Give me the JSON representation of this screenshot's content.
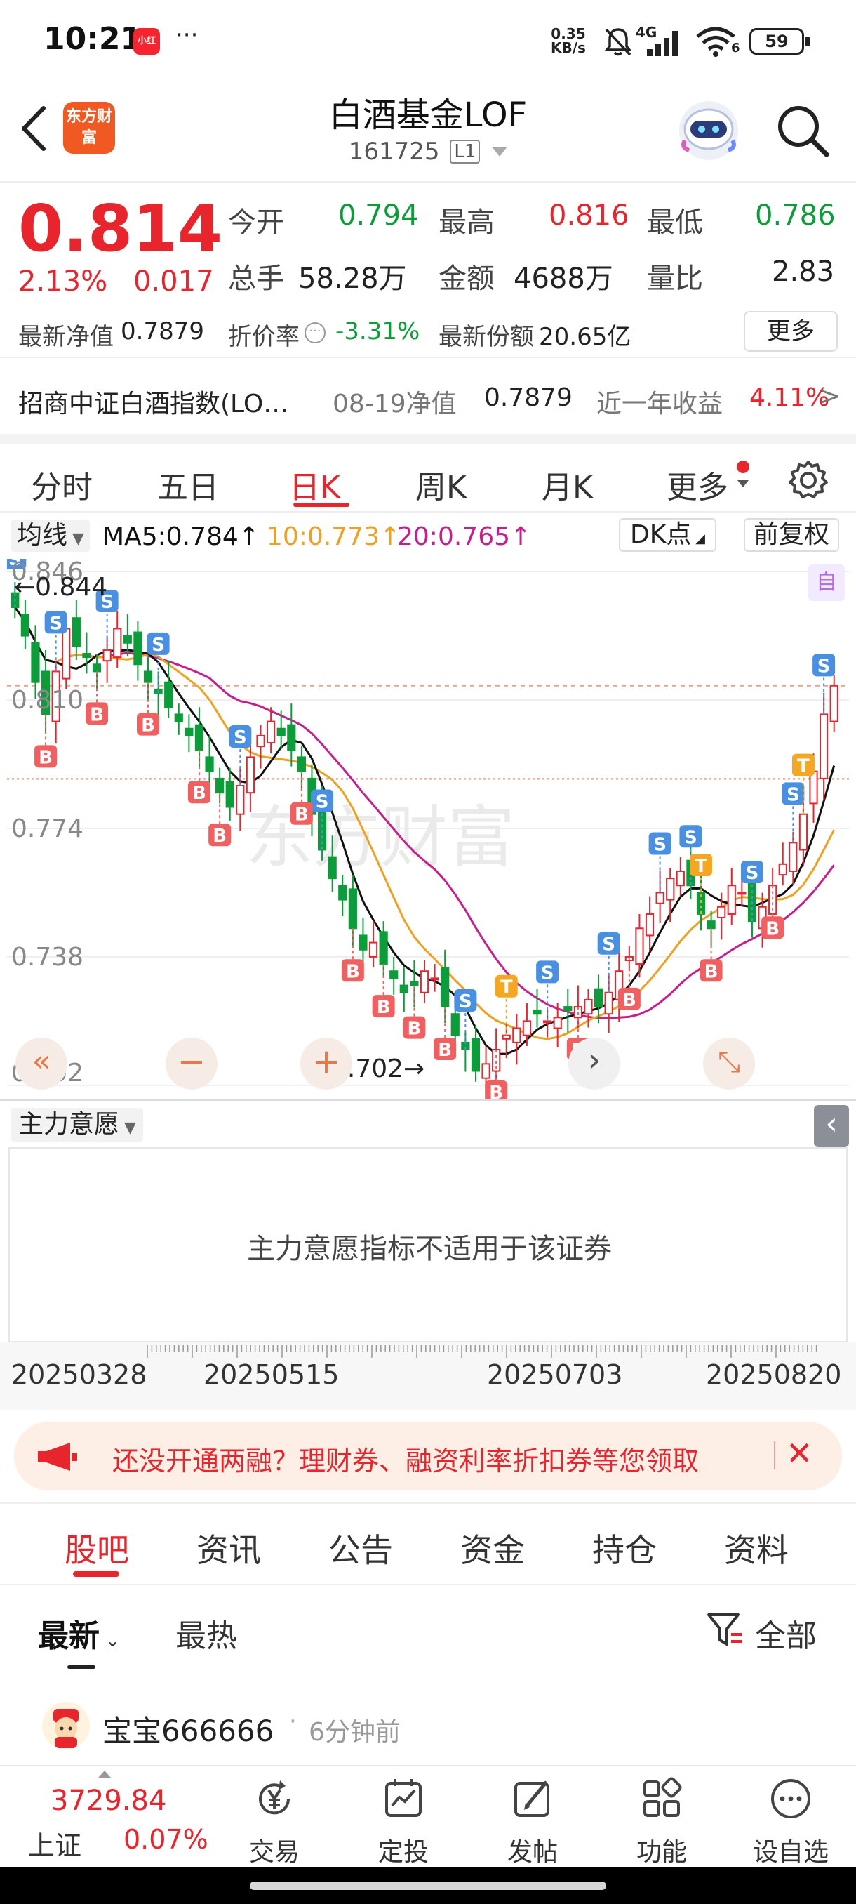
{
  "status": {
    "time": "10:21",
    "xhs_label": "小红书",
    "more_dots": "···",
    "net_speed": "0.35",
    "net_unit": "KB/s",
    "signal": "4G",
    "wifi_num": "6",
    "battery": "59"
  },
  "header": {
    "logo": "东方财富",
    "title": "白酒基金LOF",
    "code": "161725",
    "level_badge": "L1"
  },
  "quote": {
    "price": "0.814",
    "change_pct": "2.13%",
    "change": "0.017",
    "open_label": "今开",
    "open": "0.794",
    "high_label": "最高",
    "high": "0.816",
    "low_label": "最低",
    "low": "0.786",
    "volume_label": "总手",
    "volume": "58.28万",
    "amount_label": "金额",
    "amount": "4688万",
    "ratio_label": "量比",
    "ratio": "2.83",
    "nav_label": "最新净值",
    "nav": "0.7879",
    "discount_label": "折价率",
    "discount": "-3.31%",
    "shares_label": "最新份额",
    "shares": "20.65亿",
    "more": "更多"
  },
  "index_row": {
    "name": "招商中证白酒指数(LO…",
    "nav_date": "08-19净值",
    "nav_value": "0.7879",
    "ret_label": "近一年收益",
    "ret": "4.11%",
    "arrow": ">"
  },
  "period_tabs": [
    "分时",
    "五日",
    "日K",
    "周K",
    "月K",
    "更多"
  ],
  "active_period": 2,
  "ma_row": {
    "selector": "均线",
    "ma5": "MA5:0.784↑",
    "ma10": "10:0.773↑",
    "ma20": "20:0.765↑",
    "dk": "DK点",
    "adjust": "前复权"
  },
  "colors": {
    "up": "#e8242d",
    "down": "#0c9d3a",
    "ma5": "#111111",
    "ma10": "#f0a020",
    "ma20": "#c81e8c",
    "buy": "#f06060",
    "sell": "#4a90e2",
    "t_marker": "#f5a623"
  },
  "chart_data": {
    "type": "candlestick",
    "y_ticks": [
      "0.846",
      "0.810",
      "0.774",
      "0.738",
      "0.702"
    ],
    "ylim": [
      0.7,
      0.848
    ],
    "max_label": "0.844",
    "min_label": "0.702",
    "corner_badge": "自",
    "x_ticks": [
      "20250328",
      "20250515",
      "20250703",
      "20250820"
    ],
    "closes": [
      0.836,
      0.828,
      0.815,
      0.806,
      0.818,
      0.83,
      0.825,
      0.822,
      0.818,
      0.824,
      0.83,
      0.826,
      0.82,
      0.815,
      0.812,
      0.808,
      0.804,
      0.8,
      0.796,
      0.79,
      0.784,
      0.78,
      0.786,
      0.794,
      0.8,
      0.804,
      0.8,
      0.796,
      0.79,
      0.778,
      0.768,
      0.76,
      0.754,
      0.746,
      0.74,
      0.742,
      0.736,
      0.732,
      0.728,
      0.73,
      0.734,
      0.732,
      0.724,
      0.716,
      0.712,
      0.706,
      0.708,
      0.712,
      0.716,
      0.718,
      0.72,
      0.722,
      0.72,
      0.721,
      0.723,
      0.724,
      0.726,
      0.724,
      0.728,
      0.734,
      0.738,
      0.746,
      0.75,
      0.756,
      0.76,
      0.762,
      0.758,
      0.75,
      0.746,
      0.752,
      0.758,
      0.756,
      0.748,
      0.752,
      0.758,
      0.764,
      0.77,
      0.778,
      0.79,
      0.806,
      0.814
    ],
    "sell_markers": [
      "S"
    ],
    "buy_markers": [
      "B"
    ],
    "t_markers": [
      "T"
    ]
  },
  "chart_controls": {
    "collapse": "«",
    "zoom_out": "−",
    "zoom_in": "+",
    "next": "›",
    "expand": "⤡"
  },
  "indicator": {
    "selector": "主力意愿",
    "message": "主力意愿指标不适用于该证券",
    "collapse": "‹"
  },
  "banner": {
    "text": "还没开通两融？理财券、融资利率折扣券等您领取",
    "close": "✕"
  },
  "content_tabs": [
    "股吧",
    "资讯",
    "公告",
    "资金",
    "持仓",
    "资料"
  ],
  "active_content_tab": 0,
  "sort": {
    "latest": "最新",
    "hot": "最热",
    "filter": "全部"
  },
  "post": {
    "user": "宝宝666666",
    "sep": "·",
    "time": "6分钟前"
  },
  "bottom_nav": {
    "index_value": "3729.84",
    "index_name": "上证",
    "index_change": "0.07%",
    "items": [
      "交易",
      "定投",
      "发帖",
      "功能",
      "设自选"
    ]
  }
}
